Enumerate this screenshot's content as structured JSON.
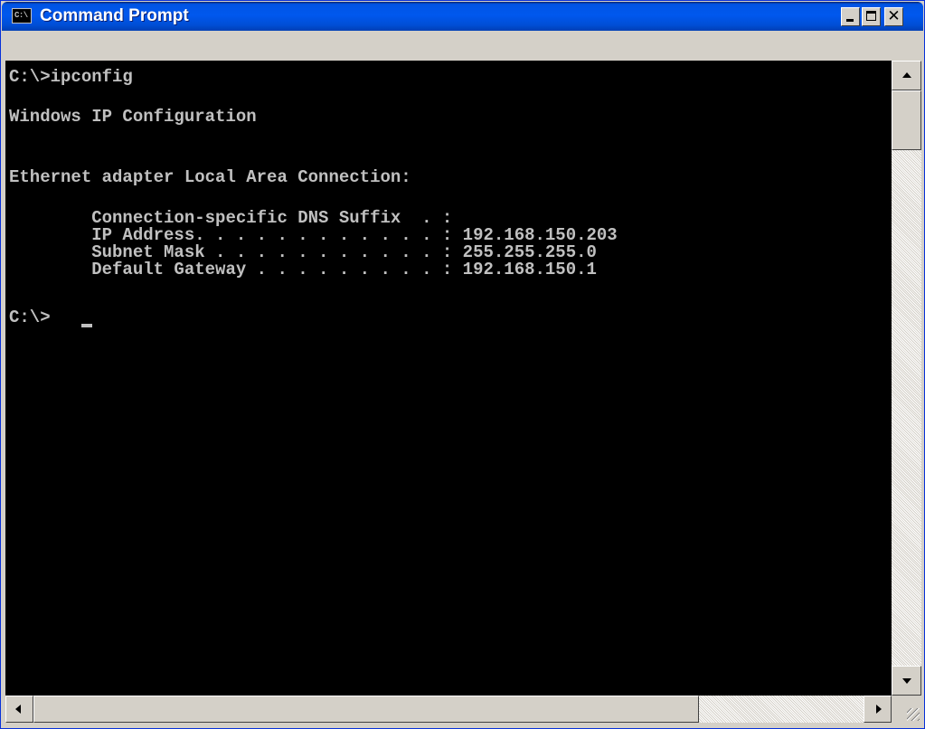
{
  "window": {
    "title": "Command Prompt",
    "icon_name": "console-app-icon",
    "icon_text": "C:\\"
  },
  "console": {
    "lines": [
      "C:\\>ipconfig",
      "",
      "Windows IP Configuration",
      "",
      "",
      "Ethernet adapter Local Area Connection:",
      "",
      "        Connection-specific DNS Suffix  . :",
      "        IP Address. . . . . . . . . . . . : 192.168.150.203",
      "        Subnet Mask . . . . . . . . . . . : 255.255.255.0",
      "        Default Gateway . . . . . . . . . : 192.168.150.1",
      "",
      "C:\\>"
    ],
    "text_color": "#c0c0c0",
    "background_color": "#000000"
  },
  "colors": {
    "titlebar": "#0058ee",
    "window_chrome": "#d4d0c8"
  }
}
